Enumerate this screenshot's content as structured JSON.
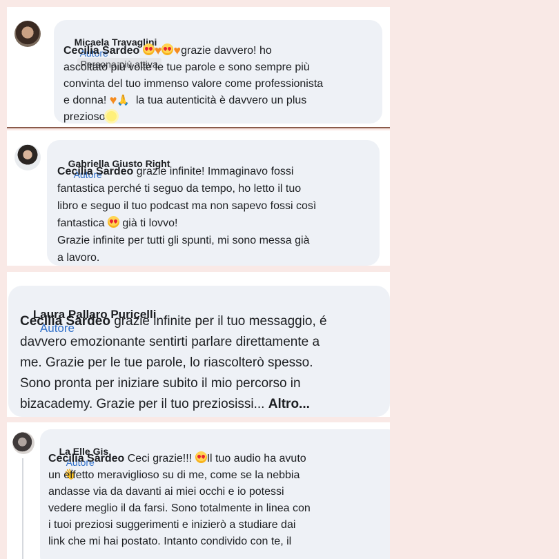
{
  "comments": [
    {
      "author": "Micaela Travaglini",
      "badge": "Autore",
      "extra_badge": "Persona più attiva",
      "mention": "Cecilia Sardeo",
      "text_1": "grazie davvero! ho",
      "text_2": "ascoltato più volte le tue parole e sono sempre più",
      "text_3": "convinta del tuo immenso valore come professionista",
      "text_4a": "e donna!",
      "text_4b": "la tua autenticità è davvero un plus",
      "text_5": "prezioso"
    },
    {
      "author": "Gabriella Giusto Right",
      "badge": "Autore",
      "mention": "Cecilia Sardeo",
      "text_1": "grazie infinite! Immaginavo fossi",
      "text_2": "fantastica perché ti seguo da tempo, ho letto il tuo",
      "text_3": "libro e seguo il tuo podcast ma non sapevo fossi così",
      "text_4a": "fantastica",
      "text_4b": "già ti lovvo!",
      "text_5": "Grazie infinite per tutti gli spunti, mi sono messa già",
      "text_6": "a lavoro."
    },
    {
      "author": "Laura Pallaro Puricelli",
      "badge": "Autore",
      "mention": "Cecilia Sardeo",
      "text_1": "grazie infinite per il tuo messaggio, é",
      "text_2": "davvero emozionante sentirti parlare direttamente a",
      "text_3": "me. Grazie per le tue parole, lo riascolterò spesso.",
      "text_4": "Sono pronta per iniziare subito il mio percorso in",
      "text_5": "bizacademy. Grazie per il tuo preziosissi...",
      "more": "Altro..."
    },
    {
      "author": "La Elle Gis",
      "badge": "Autore",
      "mention": "Cecilia Sardeo",
      "text_1a": "Ceci grazie!!!",
      "text_1b": "Il tuo audio ha avuto",
      "text_2": "un effetto meraviglioso su di me, come se la nebbia",
      "text_3": "andasse via da davanti ai miei occhi e io potessi",
      "text_4": "vedere meglio il da farsi. Sono totalmente in linea con",
      "text_5": "i tuoi preziosi suggerimenti e inizierò a studiare dai",
      "text_6": "link che mi hai postato. Intanto condivido con te, il"
    }
  ],
  "icons": [
    "avatar",
    "heart-eyes-emoji",
    "orange-heart-emoji",
    "praying-hands-emoji",
    "sun-emoji",
    "waving-hand-emoji"
  ]
}
